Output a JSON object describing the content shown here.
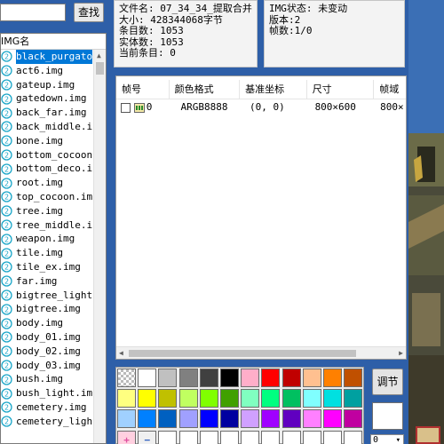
{
  "search": {
    "value": "",
    "button_label": "查找"
  },
  "file_list": {
    "header": "IMG名",
    "items": [
      "black_purgato",
      "act6.img",
      "gateup.img",
      "gatedown.img",
      "back_far.img",
      "back_middle.i",
      "bone.img",
      "bottom_cocoon",
      "bottom_deco.i",
      "root.img",
      "top_cocoon.im",
      "tree.img",
      "tree_middle.i",
      "weapon.img",
      "tile.img",
      "tile_ex.img",
      "far.img",
      "bigtree_light",
      "bigtree.img",
      "body.img",
      "body_01.img",
      "body_02.img",
      "body_03.img",
      "bush.img",
      "bush_light.im",
      "cemetery.img",
      "cemetery_ligh"
    ],
    "selected_index": 0
  },
  "file_info": {
    "filename": "文件名: 07_34_34_提取合并",
    "size": "大小: 428344068字节",
    "entries": "条目数: 1053",
    "entities": "实体数: 1053",
    "current": "当前条目: 0"
  },
  "img_info": {
    "status": "IMG状态: 未变动",
    "version": "版本:2",
    "frames": "帧数:1/0"
  },
  "frame_table": {
    "columns": [
      "帧号",
      "颜色格式",
      "基准坐标",
      "尺寸",
      "帧域"
    ],
    "rows": [
      {
        "index": "0",
        "format": "ARGB8888",
        "coord": "(0, 0)",
        "size": "800×600",
        "domain": "800×"
      }
    ]
  },
  "palette": {
    "colors": [
      [
        "checker",
        "#ffffff",
        "#c0c0c0",
        "#808080",
        "#404040",
        "#000000",
        "#ffaec9",
        "#ff0000",
        "#c00000",
        "#ffc090",
        "#ff8000",
        "#c05000"
      ],
      [
        "#ffff80",
        "#ffff00",
        "#c0c000",
        "#c0ff60",
        "#80ff00",
        "#40a000",
        "#80ffc0",
        "#00ff80",
        "#00c060",
        "#80ffff",
        "#00e0e0",
        "#00a0a0"
      ],
      [
        "#a0d0ff",
        "#0080ff",
        "#0060c0",
        "#a0a0ff",
        "#0000ff",
        "#0000a0",
        "#d0a0ff",
        "#a000ff",
        "#6000c0",
        "#ff80ff",
        "#ff00ff",
        "#c000a0"
      ],
      [
        "#ffd0e0",
        "#f0f0f0",
        "#ffffff",
        "#ffffff",
        "#ffffff",
        "#ffffff",
        "#ffffff",
        "#ffffff",
        "#ffffff",
        "#ffffff",
        "#ffffff",
        "#ffffff"
      ]
    ],
    "adjust_label": "调节",
    "select_value": "0",
    "add_symbol": "+",
    "remove_symbol": "−"
  },
  "colors": {
    "selection": "#0078d7",
    "icon_cyan": "#1aa6c8"
  }
}
